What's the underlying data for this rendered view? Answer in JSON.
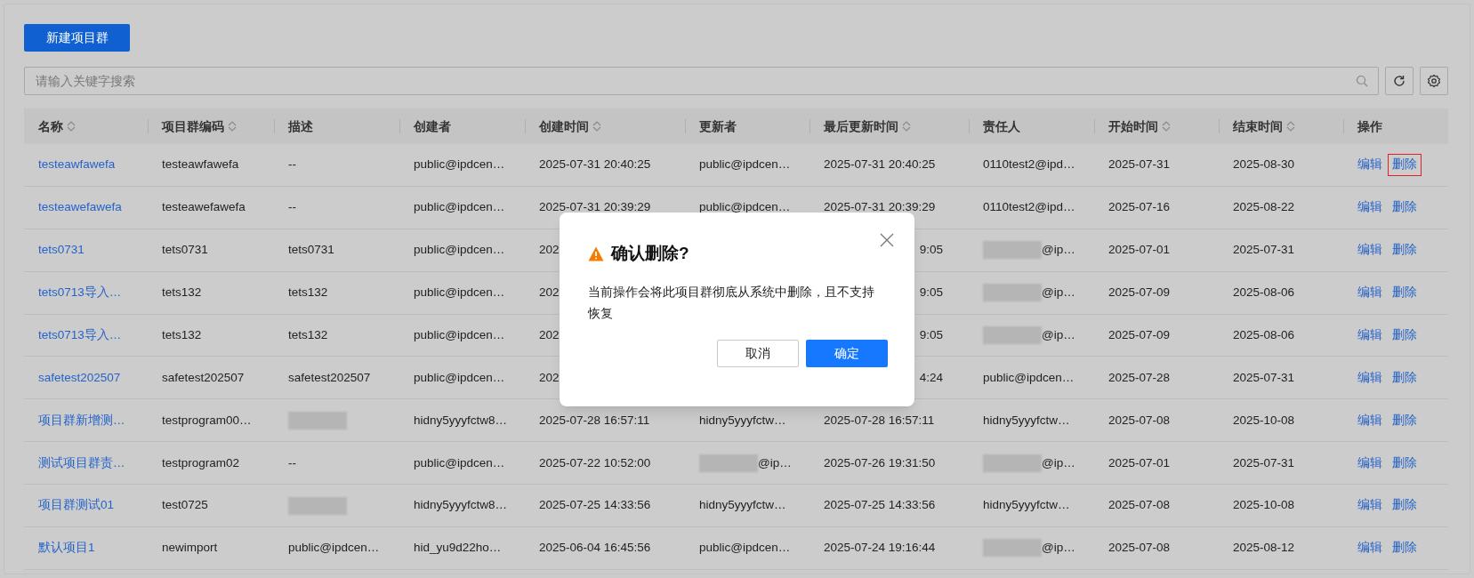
{
  "toolbar": {
    "create_button": "新建项目群",
    "search": {
      "placeholder": "请输入关键字搜索"
    }
  },
  "table": {
    "columns": [
      {
        "label": "名称",
        "sortable": true
      },
      {
        "label": "项目群编码",
        "sortable": true
      },
      {
        "label": "描述",
        "sortable": false
      },
      {
        "label": "创建者",
        "sortable": false
      },
      {
        "label": "创建时间",
        "sortable": true
      },
      {
        "label": "更新者",
        "sortable": false
      },
      {
        "label": "最后更新时间",
        "sortable": true
      },
      {
        "label": "责任人",
        "sortable": false
      },
      {
        "label": "开始时间",
        "sortable": true
      },
      {
        "label": "结束时间",
        "sortable": true
      },
      {
        "label": "操作",
        "sortable": false
      }
    ],
    "rows": [
      {
        "cells": [
          {
            "text": "testeawfawefa"
          },
          {
            "text": "testeawfawefa"
          },
          {
            "text": "--"
          },
          {
            "text": "public@ipdcen…"
          },
          {
            "text": "2025-07-31 20:40:25"
          },
          {
            "text": "public@ipdcen…"
          },
          {
            "text": "2025-07-31 20:40:25"
          },
          {
            "text": "0110test2@ipd…"
          },
          {
            "text": "2025-07-31"
          },
          {
            "text": "2025-08-30"
          }
        ],
        "edit": "编辑",
        "delete": "删除",
        "highlighted": true
      },
      {
        "cells": [
          {
            "text": "testeawefawefa"
          },
          {
            "text": "testeawefawefa"
          },
          {
            "text": "--"
          },
          {
            "text": "public@ipdcen…"
          },
          {
            "text": "2025-07-31 20:39:29"
          },
          {
            "text": "public@ipdcen…"
          },
          {
            "text": "2025-07-31 20:39:29"
          },
          {
            "text": "0110test2@ipd…"
          },
          {
            "text": "2025-07-16"
          },
          {
            "text": "2025-08-22"
          }
        ],
        "edit": "编辑",
        "delete": "删除",
        "highlighted": false
      },
      {
        "cells": [
          {
            "text": "tets0731"
          },
          {
            "text": "tets0731"
          },
          {
            "text": "tets0731"
          },
          {
            "text": "public@ipdcen…"
          },
          {
            "text": "202"
          },
          {},
          {
            "text": "9:05",
            "covered": true
          },
          {
            "text": "@ip…",
            "redacted": true
          },
          {
            "text": "2025-07-01"
          },
          {
            "text": "2025-07-31"
          }
        ],
        "edit": "编辑",
        "delete": "删除",
        "highlighted": false
      },
      {
        "cells": [
          {
            "text": "tets0713导入…"
          },
          {
            "text": "tets132"
          },
          {
            "text": "tets132"
          },
          {
            "text": "public@ipdcen…"
          },
          {
            "text": "202"
          },
          {},
          {
            "text": "9:05",
            "covered": true
          },
          {
            "text": "@ip…",
            "redacted": true
          },
          {
            "text": "2025-07-09"
          },
          {
            "text": "2025-08-06"
          }
        ],
        "edit": "编辑",
        "delete": "删除",
        "highlighted": false
      },
      {
        "cells": [
          {
            "text": "tets0713导入…"
          },
          {
            "text": "tets132"
          },
          {
            "text": "tets132"
          },
          {
            "text": "public@ipdcen…"
          },
          {
            "text": "202"
          },
          {},
          {
            "text": "9:05",
            "covered": true
          },
          {
            "text": "@ip…",
            "redacted": true
          },
          {
            "text": "2025-07-09"
          },
          {
            "text": "2025-08-06"
          }
        ],
        "edit": "编辑",
        "delete": "删除",
        "highlighted": false
      },
      {
        "cells": [
          {
            "text": "safetest202507"
          },
          {
            "text": "safetest202507"
          },
          {
            "text": "safetest202507"
          },
          {
            "text": "public@ipdcen…"
          },
          {
            "text": "202"
          },
          {},
          {
            "text": "4:24",
            "covered": true
          },
          {
            "text": "public@ipdcen…"
          },
          {
            "text": "2025-07-28"
          },
          {
            "text": "2025-07-31"
          }
        ],
        "edit": "编辑",
        "delete": "删除",
        "highlighted": false
      },
      {
        "cells": [
          {
            "text": "项目群新增测…"
          },
          {
            "text": "testprogram00…"
          },
          {
            "redacted": true
          },
          {
            "text": "hidny5yyyfctw8…"
          },
          {
            "text": "2025-07-28 16:57:11"
          },
          {
            "text": "hidny5yyyfctw…"
          },
          {
            "text": "2025-07-28 16:57:11"
          },
          {
            "text": "hidny5yyyfctw…"
          },
          {
            "text": "2025-07-08"
          },
          {
            "text": "2025-10-08"
          }
        ],
        "edit": "编辑",
        "delete": "删除",
        "highlighted": false
      },
      {
        "cells": [
          {
            "text": "测试项目群责…"
          },
          {
            "text": "testprogram02"
          },
          {
            "text": "--"
          },
          {
            "text": "public@ipdcen…"
          },
          {
            "text": "2025-07-22 10:52:00"
          },
          {
            "text": "@ip…",
            "redacted": true
          },
          {
            "text": "2025-07-26 19:31:50"
          },
          {
            "text": "@ip…",
            "redacted": true
          },
          {
            "text": "2025-07-01"
          },
          {
            "text": "2025-07-31"
          }
        ],
        "edit": "编辑",
        "delete": "删除",
        "highlighted": false
      },
      {
        "cells": [
          {
            "text": "项目群测试01"
          },
          {
            "text": "test0725"
          },
          {
            "redacted": true
          },
          {
            "text": "hidny5yyyfctw8…"
          },
          {
            "text": "2025-07-25 14:33:56"
          },
          {
            "text": "hidny5yyyfctw…"
          },
          {
            "text": "2025-07-25 14:33:56"
          },
          {
            "text": "hidny5yyyfctw…"
          },
          {
            "text": "2025-07-08"
          },
          {
            "text": "2025-10-08"
          }
        ],
        "edit": "编辑",
        "delete": "删除",
        "highlighted": false
      },
      {
        "cells": [
          {
            "text": "默认项目1"
          },
          {
            "text": "newimport"
          },
          {
            "text": "public@ipdcen…"
          },
          {
            "text": "hid_yu9d22ho…"
          },
          {
            "text": "2025-06-04 16:45:56"
          },
          {
            "text": "public@ipdcen…"
          },
          {
            "text": "2025-07-24 19:16:44"
          },
          {
            "text": "@ip…",
            "redacted": true
          },
          {
            "text": "2025-07-08"
          },
          {
            "text": "2025-08-12"
          }
        ],
        "edit": "编辑",
        "delete": "删除",
        "highlighted": false
      }
    ]
  },
  "dialog": {
    "title": "确认删除?",
    "message": "当前操作会将此项目群彻底从系统中删除，且不支持恢复",
    "buttons": [
      {
        "label": "取消",
        "kind": "secondary"
      },
      {
        "label": "确定",
        "kind": "primary"
      }
    ]
  }
}
